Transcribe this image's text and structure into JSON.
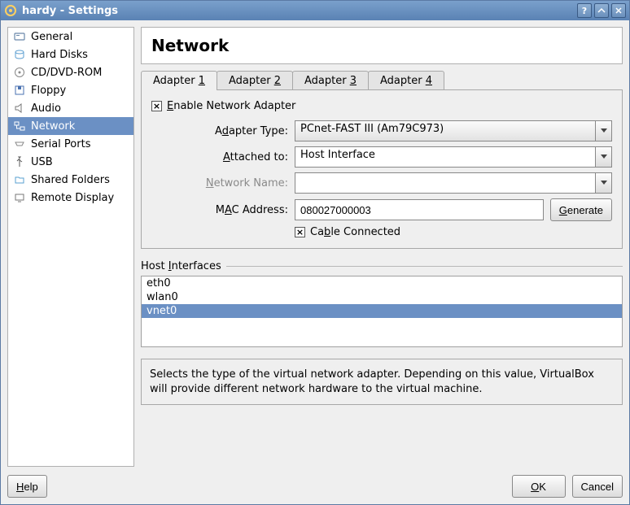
{
  "window": {
    "title": "hardy - Settings"
  },
  "sidebar": {
    "items": [
      {
        "label": "General"
      },
      {
        "label": "Hard Disks"
      },
      {
        "label": "CD/DVD-ROM"
      },
      {
        "label": "Floppy"
      },
      {
        "label": "Audio"
      },
      {
        "label": "Network"
      },
      {
        "label": "Serial Ports"
      },
      {
        "label": "USB"
      },
      {
        "label": "Shared Folders"
      },
      {
        "label": "Remote Display"
      }
    ]
  },
  "page": {
    "title": "Network"
  },
  "tabs": [
    {
      "prefix": "Adapter ",
      "key": "1"
    },
    {
      "prefix": "Adapter ",
      "key": "2"
    },
    {
      "prefix": "Adapter ",
      "key": "3"
    },
    {
      "prefix": "Adapter ",
      "key": "4"
    }
  ],
  "adapter": {
    "enable_prefix": "E",
    "enable_suffix": "nable Network Adapter",
    "enable_checked": true,
    "type_label_pre": "A",
    "type_label_u": "d",
    "type_label_post": "apter Type:",
    "type_value": "PCnet-FAST III (Am79C973)",
    "attached_label_u": "A",
    "attached_label_post": "ttached to:",
    "attached_value": "Host Interface",
    "netname_label_u": "N",
    "netname_label_post": "etwork Name:",
    "netname_value": "",
    "mac_label_pre": "M",
    "mac_label_u": "A",
    "mac_label_post": "C Address:",
    "mac_value": "080027000003",
    "generate_u": "G",
    "generate_post": "enerate",
    "cable_pre": "Ca",
    "cable_u": "b",
    "cable_post": "le Connected",
    "cable_checked": true
  },
  "host_interfaces": {
    "title_pre": "Host ",
    "title_u": "I",
    "title_post": "nterfaces",
    "items": [
      "eth0",
      "wlan0",
      "vnet0"
    ],
    "selected": "vnet0"
  },
  "description": "Selects the type of the virtual network adapter. Depending on this value, VirtualBox will provide different network hardware to the virtual machine.",
  "buttons": {
    "help_u": "H",
    "help_post": "elp",
    "ok_u": "O",
    "ok_post": "K",
    "cancel": "Cancel"
  }
}
